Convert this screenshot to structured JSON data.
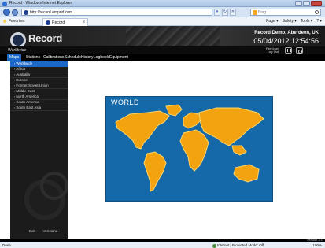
{
  "browser": {
    "title": "Record - Windows Internet Explorer",
    "url": "http://record.emprid.com",
    "search_placeholder": "Bing",
    "favorites_label": "Favorites",
    "tab_label": "Record",
    "tab_close": "x",
    "commands": [
      "Page ▾",
      "Safety ▾",
      "Tools ▾",
      "? ▾"
    ]
  },
  "header": {
    "logo_text": "Record",
    "account": "Record Demo, Aberdeen, UK",
    "datetime": "05/04/2012 12:54:56"
  },
  "subheader": {
    "site": "Worldwide",
    "user_line1": "File User",
    "user_line2": "Log Out"
  },
  "nav": {
    "tabs": [
      {
        "label": "Maps",
        "active": true
      },
      {
        "label": "Stations",
        "active": false
      },
      {
        "label": "Calibrations",
        "active": false
      },
      {
        "label": "Schedule",
        "active": false
      },
      {
        "label": "History",
        "active": false
      },
      {
        "label": "Logbook",
        "active": false
      },
      {
        "label": "Equipment",
        "active": false
      }
    ]
  },
  "sidebar": {
    "items": [
      {
        "label": "Worldwide",
        "active": true
      },
      {
        "label": "Africa",
        "active": false
      },
      {
        "label": "Australia",
        "active": false
      },
      {
        "label": "Europe",
        "active": false
      },
      {
        "label": "Former Soviet Union",
        "active": false
      },
      {
        "label": "Middle East",
        "active": false
      },
      {
        "label": "North America",
        "active": false
      },
      {
        "label": "South America",
        "active": false
      },
      {
        "label": "South East Asia",
        "active": false
      }
    ],
    "arrow": "›",
    "buttons": [
      "Exit",
      "Veristand"
    ]
  },
  "map": {
    "title": "WORLD",
    "ocean_color": "#1669a8",
    "land_color": "#f2a30f"
  },
  "footer": {
    "version": "Version 3.1"
  },
  "status": {
    "done": "Done",
    "zone": "Internet | Protected Mode: Off",
    "zoom": "100%"
  }
}
